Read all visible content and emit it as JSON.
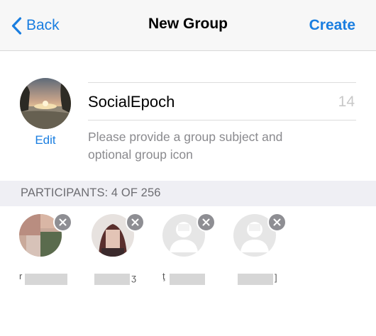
{
  "navbar": {
    "back_label": "Back",
    "title": "New Group",
    "create_label": "Create"
  },
  "group": {
    "edit_label": "Edit",
    "subject_value": "SocialEpoch",
    "char_count": "14",
    "hint": "Please provide a group subject and optional group icon"
  },
  "participants": {
    "header": "PARTICIPANTS: 4 OF 256",
    "items": [
      {
        "name": "r"
      },
      {
        "name": "ӡ"
      },
      {
        "name": "ţ"
      },
      {
        "name": "]"
      }
    ]
  },
  "colors": {
    "accent": "#1a7ee0",
    "navbar_bg": "#f7f7f7",
    "section_bg": "#efeff4",
    "remove_badge": "#8e8e93"
  }
}
